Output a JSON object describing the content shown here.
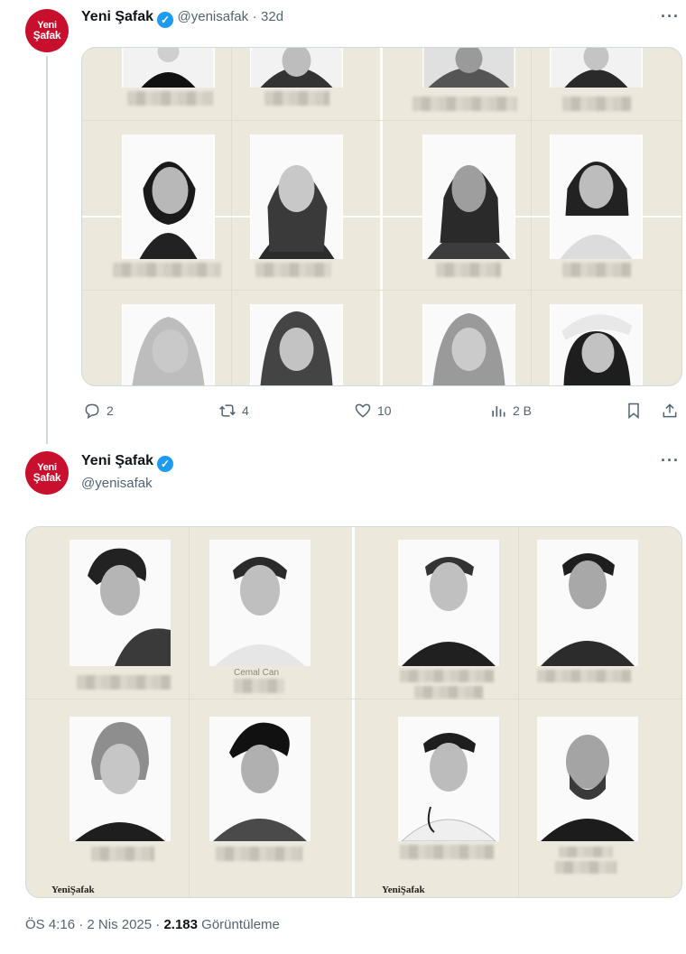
{
  "tweet1": {
    "display_name": "Yeni Şafak",
    "handle": "@yenisafak",
    "time": "32d",
    "actions": {
      "replies": "2",
      "retweets": "4",
      "likes": "10",
      "views": "2 B"
    }
  },
  "tweet2": {
    "display_name": "Yeni Şafak",
    "handle": "@yenisafak",
    "caption_partial": "Cemal Can",
    "logo_left": "YeniŞafak",
    "logo_right": "YeniŞafak",
    "footer": {
      "time": "ÖS 4:16",
      "date": "2 Nis 2025",
      "views_count": "2.183",
      "views_label": "Görüntüleme",
      "sep": "·"
    }
  },
  "avatar": {
    "line1": "Yeni",
    "line2": "Şafak"
  },
  "icons": [
    "more-icon",
    "verified-icon",
    "reply-icon",
    "retweet-icon",
    "like-icon",
    "views-icon",
    "bookmark-icon",
    "share-icon"
  ],
  "colors": {
    "brand": "#c8102e",
    "verified": "#1d9bf0",
    "muted": "#536471",
    "media_bg": "#ece8dc"
  }
}
